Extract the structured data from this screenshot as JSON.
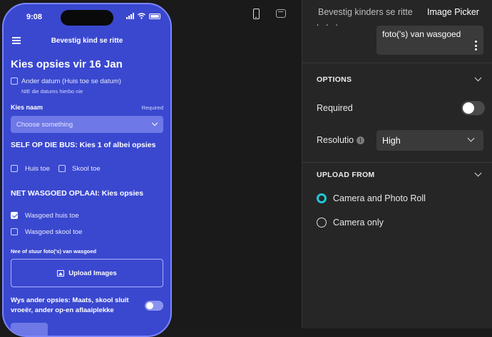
{
  "preview": {
    "status_time": "9:08",
    "app_title": "Bevestig kind se ritte",
    "heading": "Kies opsies vir 16 Jan",
    "other_date": {
      "label": "Ander datum (Huis toe se datum)",
      "hint": "NIE die datums hierbo nie"
    },
    "child_field": {
      "label": "Kies naam",
      "required": "Required",
      "placeholder": "Choose something"
    },
    "bus_section": {
      "title": "SELF OP DIE BUS: Kies 1 of albei opsies",
      "options": [
        "Huis toe",
        "Skool toe"
      ]
    },
    "laundry_section": {
      "title": "NET WASGOED OPLAAI: Kies opsies",
      "options": [
        {
          "label": "Wasgoed huis toe",
          "checked": true
        },
        {
          "label": "Wasgoed skool toe",
          "checked": false
        }
      ]
    },
    "photo_field": {
      "label": "Nee of stuur foto('s) van wasgoed",
      "button": "Upload Images"
    },
    "other_options": {
      "label": "Wys ander opsies: Maats, skool sluit vroeër, ander op-en aflaaiplekke",
      "on": false
    }
  },
  "device_icons": [
    "phone-icon",
    "tablet-icon"
  ],
  "panel": {
    "tabs": [
      "Bevestig kinders se ritte",
      "Image Picker"
    ],
    "label_field": {
      "label": "Label",
      "value": "foto('s) van wasgoed"
    },
    "options": {
      "title": "OPTIONS",
      "required_label": "Required",
      "required_on": false,
      "resolution_label": "Resolution",
      "resolution_value": "High"
    },
    "upload_from": {
      "title": "UPLOAD FROM",
      "choices": [
        {
          "label": "Camera and Photo Roll",
          "selected": true
        },
        {
          "label": "Camera only",
          "selected": false
        }
      ]
    }
  },
  "colors": {
    "phone_bg": "#3a48cf",
    "panel_bg": "#262626",
    "radio_accent": "#1fc7d8"
  }
}
